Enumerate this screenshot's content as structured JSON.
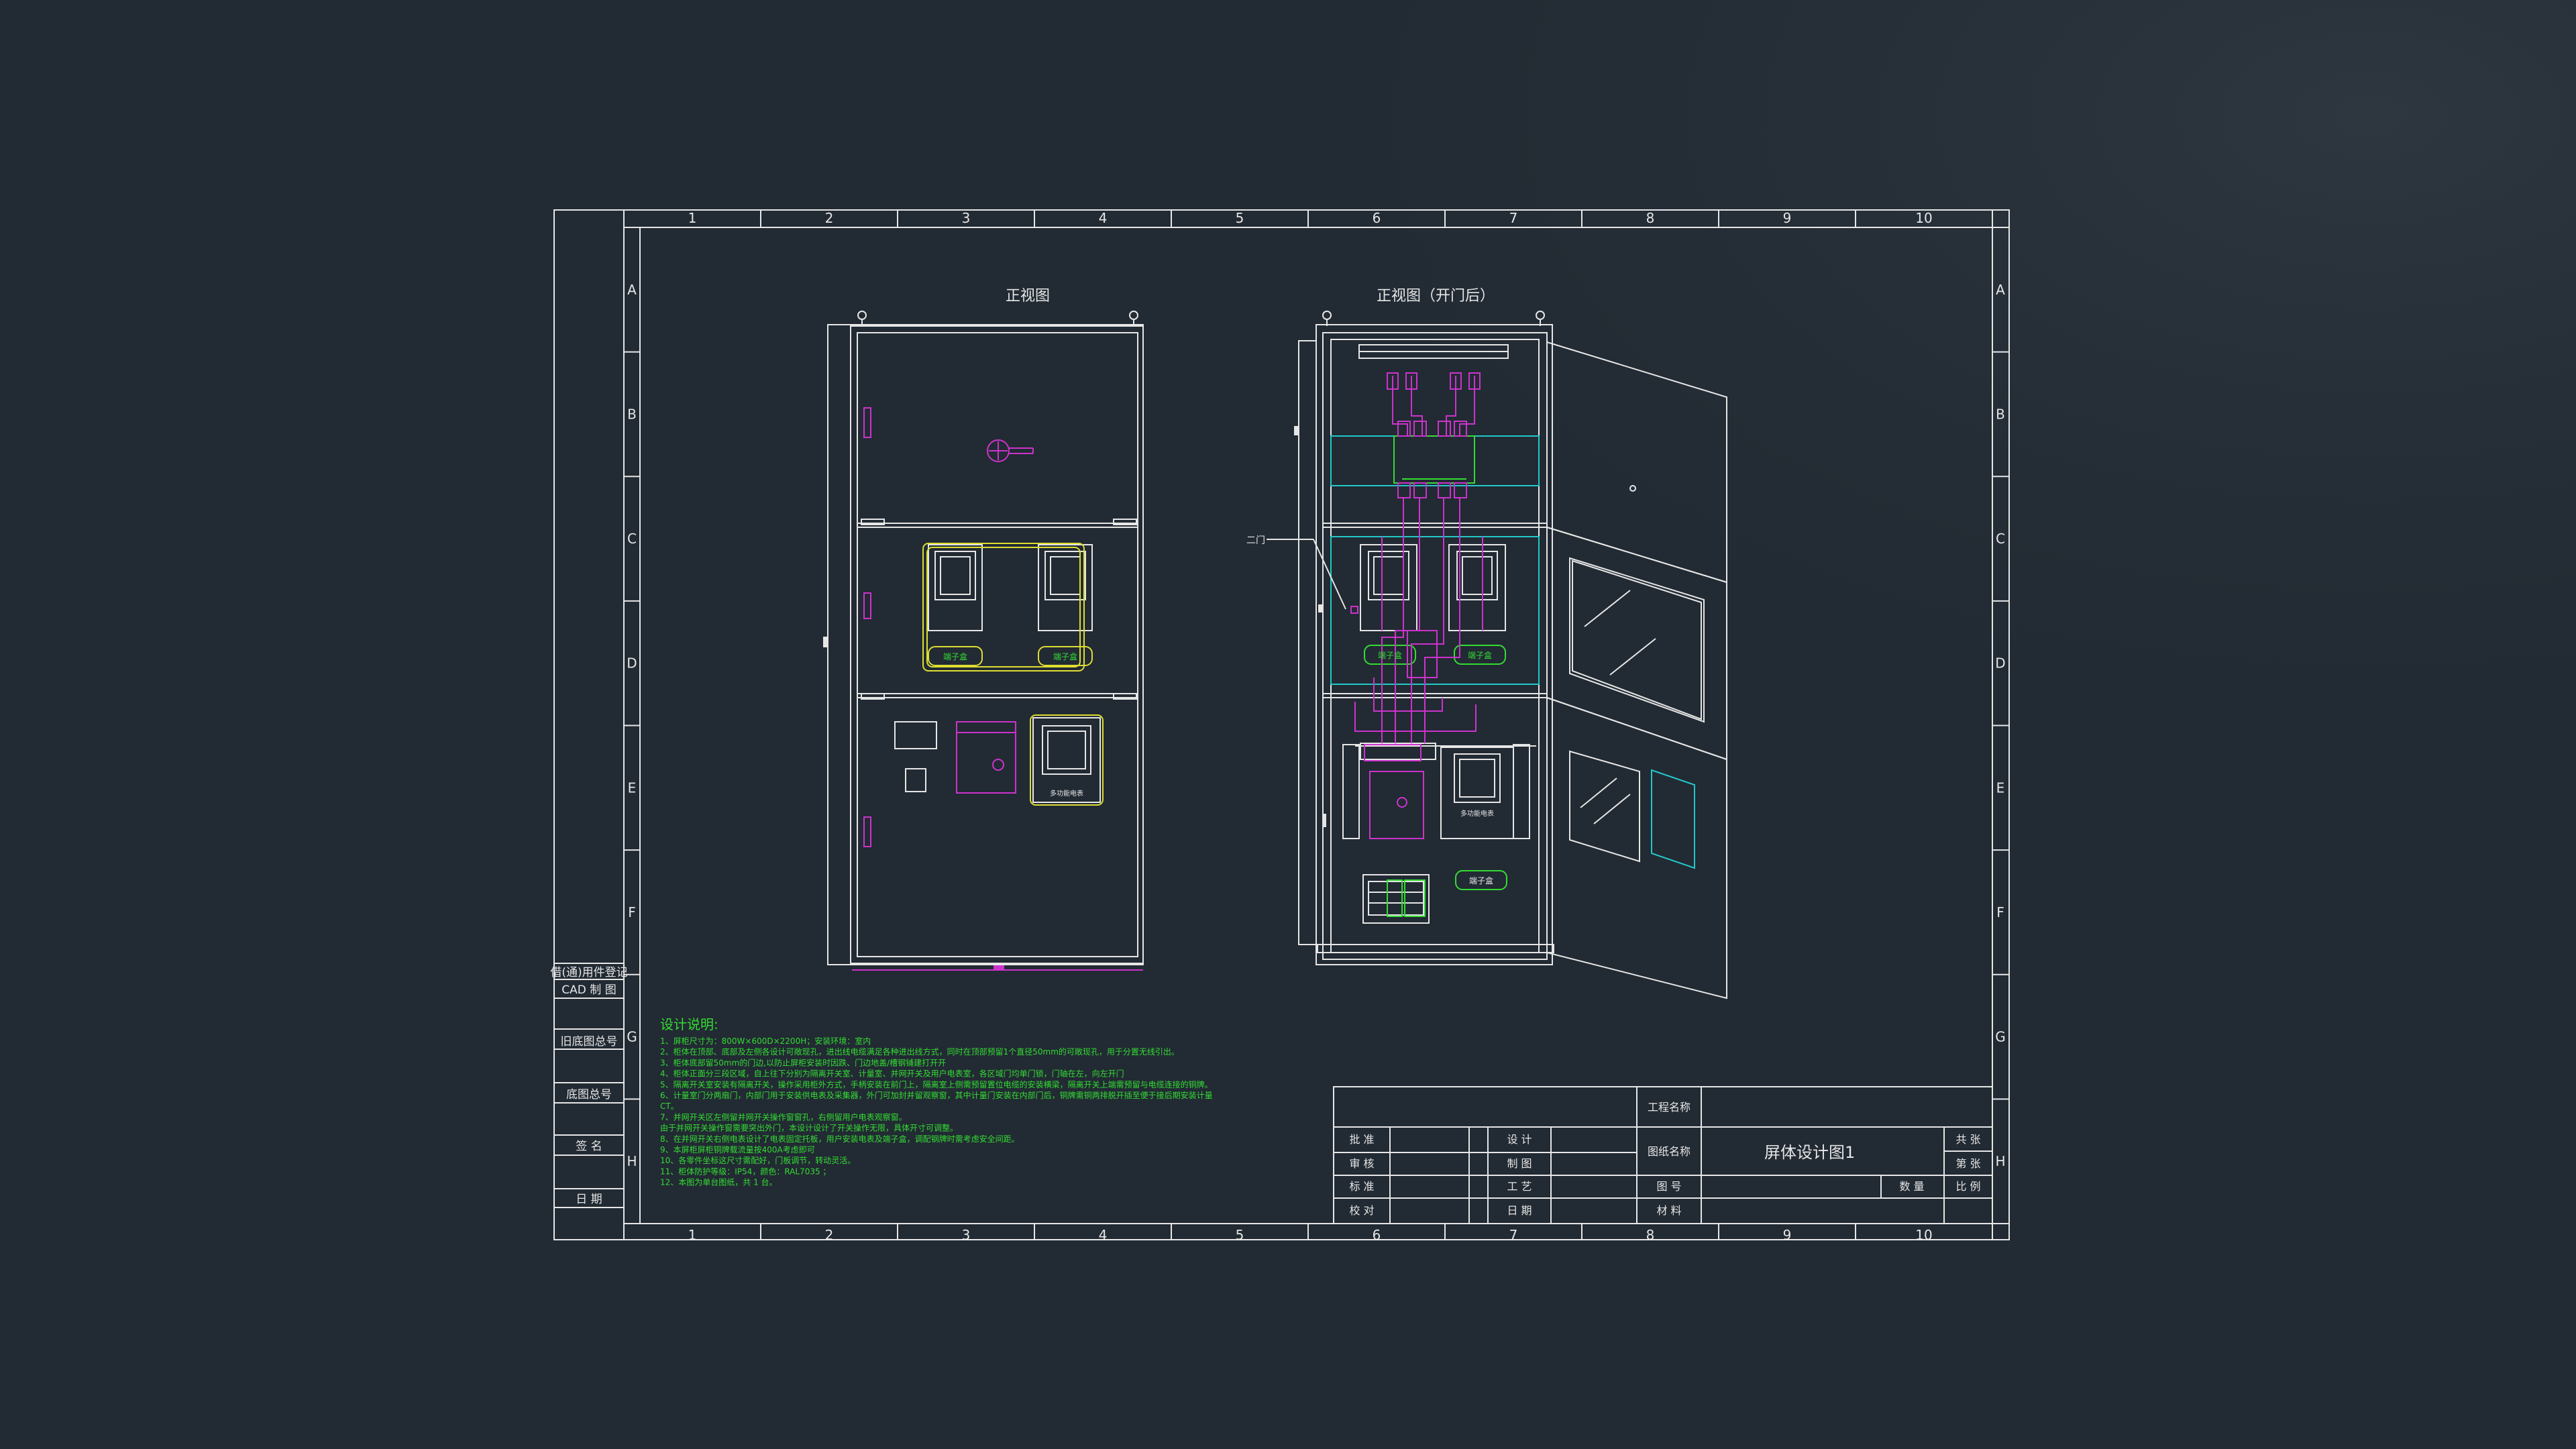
{
  "grid": {
    "columns": [
      "1",
      "2",
      "3",
      "4",
      "5",
      "6",
      "7",
      "8",
      "9",
      "10"
    ],
    "rows": [
      "A",
      "B",
      "C",
      "D",
      "E",
      "F",
      "G",
      "H"
    ]
  },
  "left_strip": {
    "items": [
      "借(通)用件登记",
      "CAD 制 图",
      "旧底图总号",
      "底图总号",
      "签 名",
      "日 期"
    ]
  },
  "views": {
    "front_title": "正视图",
    "front_open_title": "正视图（开门后）",
    "callout_label": "二门"
  },
  "labels": {
    "terminal_box": "端子盒",
    "meter_box": "多功能电表"
  },
  "notes": {
    "title": "设计说明:",
    "lines": [
      "1、屏柜尺寸为：800W×600D×2200H；安装环境：室内",
      "2、柜体在顶部、底部及左侧各设计可敞现孔，进出线电缆满足各种进出线方式，同时在顶部预留1个直径50mm的可敞现孔，用于分置无线引出。",
      "3、柜体底部留50mm的门边,以防止屏柜安装时因跌、门边地盖/槽钢铺建打开开",
      "4、柜体正面分三段区域，自上往下分别为隔离开关室、计量室、并网开关及用户电表室，各区域门均单门锁，门轴在左，向左开门",
      "5、隔离开关室安装有隔离开关，操作采用柜外方式，手柄安装在前门上，隔离室上侧需预留置位电缆的安装横梁，隔离开关上端需预留与电缆连接的铜牌。",
      "6、计量室门分两扇门，内部门用于安装供电表及采集器，外门可加封并留观察窗，其中计量门安装在内部门后，铜牌需铜两排脱开插至便于接后期安装计量",
      "CT。",
      "7、并网开关区左侧留并网开关操作窗窗孔，右侧留用户电表观察窗。",
      "   由于并网开关操作窗需要突出外门，本设计设计了开关操作无限，具体开寸可调整。",
      "8、在并网开关右侧电表设计了电表固定托板，用户安装电表及端子盒，调配钢牌时需考虑安全间距。",
      "9、本屏柜屏柜铜牌载流量按400A考虑即可",
      "10、各零件坐标这尺寸需配好，门板调节，转动灵活。",
      "11、柜体防护等级：IP54，颜色：RAL7035 ；",
      "12、本图为单台图纸，共 1 台。"
    ]
  },
  "title_block": {
    "project_name_label": "工程名称",
    "project_name_value": "",
    "drawing_name_label": "图纸名称",
    "drawing_name_value": "屏体设计图1",
    "approve": "批 准",
    "review": "审 核",
    "standard": "标 准",
    "check": "校 对",
    "design": "设 计",
    "draw": "制 图",
    "process": "工 艺",
    "date": "日 期",
    "drawing_no": "图 号",
    "material": "材 料",
    "total_sheets": "共 张",
    "sheet_no": "第 张",
    "quantity": "数 量",
    "scale": "比 例"
  },
  "colors": {
    "background": "#222a33",
    "line": "#e6e6e6",
    "magenta": "#cc33cc",
    "green": "#33dd33",
    "yellow": "#dddd33",
    "cyan": "#22c8c8"
  }
}
